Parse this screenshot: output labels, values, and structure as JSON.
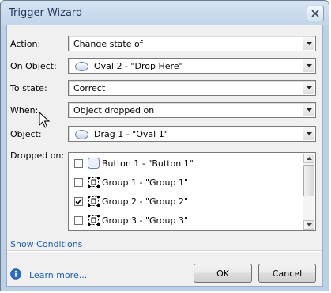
{
  "window": {
    "title": "Trigger Wizard"
  },
  "fields": {
    "action": {
      "label": "Action:",
      "value": "Change state of"
    },
    "on_object": {
      "label": "On Object:",
      "value": "Oval 2 - \"Drop Here\"",
      "icon": "oval-icon"
    },
    "to_state": {
      "label": "To state:",
      "value": "Correct"
    },
    "when": {
      "label": "When:",
      "value": "Object dropped on"
    },
    "object": {
      "label": "Object:",
      "value": "Drag 1 - \"Oval 1\"",
      "icon": "oval-icon"
    }
  },
  "dropped_on": {
    "label": "Dropped on:",
    "items": [
      {
        "label": "Button 1 - \"Button 1\"",
        "checked": false,
        "icon": "button-icon"
      },
      {
        "label": "Group 1 - \"Group 1\"",
        "checked": false,
        "icon": "group-icon"
      },
      {
        "label": "Group 2 - \"Group 2\"",
        "checked": true,
        "icon": "group-icon"
      },
      {
        "label": "Group 3 - \"Group 3\"",
        "checked": false,
        "icon": "group-icon"
      }
    ]
  },
  "links": {
    "show_conditions": "Show Conditions",
    "learn_more": "Learn more..."
  },
  "buttons": {
    "ok": "OK",
    "cancel": "Cancel"
  },
  "colors": {
    "link": "#1a5fb4",
    "title_text": "#1e395b",
    "info_icon": "#2a6fcf"
  }
}
